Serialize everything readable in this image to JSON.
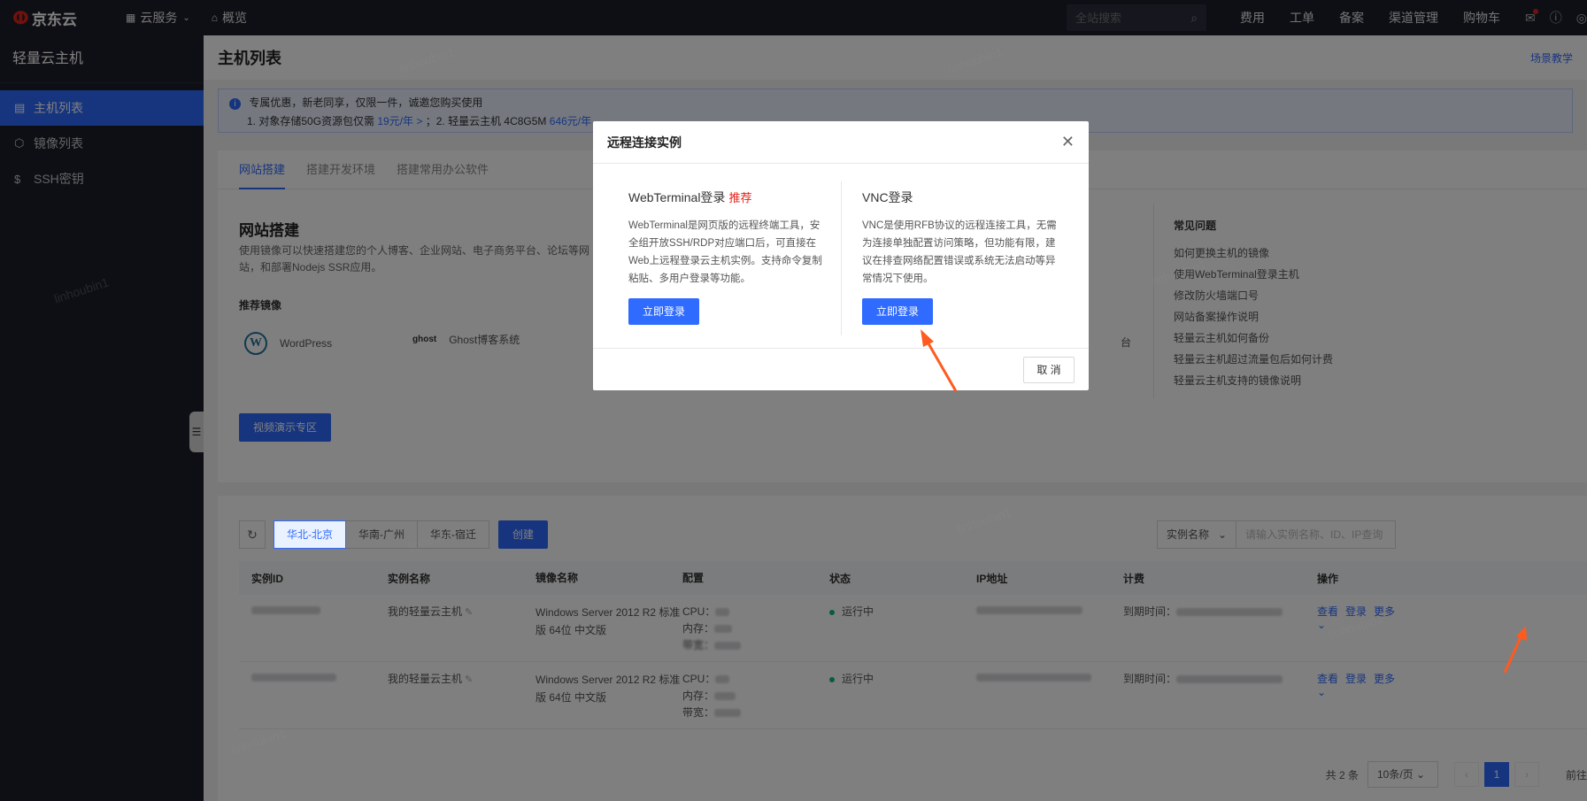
{
  "topnav": {
    "logo": "京东云",
    "cloud_services": "云服务",
    "overview": "概览",
    "search_placeholder": "全站搜索",
    "links": [
      "费用",
      "工单",
      "备案",
      "渠道管理",
      "购物车"
    ]
  },
  "sidebar": {
    "title": "轻量云主机",
    "items": [
      {
        "label": "主机列表",
        "active": true
      },
      {
        "label": "镜像列表",
        "active": false
      },
      {
        "label": "SSH密钥",
        "active": false
      }
    ]
  },
  "page": {
    "title": "主机列表",
    "scene_link": "场景教学"
  },
  "notice": {
    "line1": "专属优惠，新老同享，仅限一件，诚邀您购买使用",
    "line2_a": "1. 对象存储50G资源包仅需 ",
    "line2_price1": "19元/年 >",
    "line2_b": " ；2. 轻量云主机 4C8G5M ",
    "line2_price2": "646元/年"
  },
  "tabs": [
    "网站搭建",
    "搭建开发环境",
    "搭建常用办公软件"
  ],
  "site": {
    "title": "网站搭建",
    "desc": "使用镜像可以快速搭建您的个人博客、企业网站、电子商务平台、论坛等网站，和部署Nodejs SSR应用。",
    "recommend_title": "推荐镜像",
    "images": [
      "WordPress",
      "Ghost博客系统"
    ],
    "ghost_mark": "ghost",
    "extra_fragment": "台",
    "video_button": "视频演示专区"
  },
  "faq": {
    "title": "常见问题",
    "items": [
      "如何更换主机的镜像",
      "使用WebTerminal登录主机",
      "修改防火墙端口号",
      "网站备案操作说明",
      "轻量云主机如何备份",
      "轻量云主机超过流量包后如何计费",
      "轻量云主机支持的镜像说明"
    ]
  },
  "toolbar": {
    "regions": [
      "华北-北京",
      "华南-广州",
      "华东-宿迁"
    ],
    "create": "创建",
    "filter_select": "实例名称",
    "filter_placeholder": "请输入实例名称、ID、IP查询"
  },
  "table": {
    "headers": [
      "实例ID",
      "实例名称",
      "镜像名称",
      "配置",
      "状态",
      "IP地址",
      "计费",
      "操作"
    ],
    "rows": [
      {
        "name": "我的轻量云主机",
        "image": "Windows Server 2012 R2 标准版 64位 中文版",
        "cpu_label": "CPU：",
        "mem_label": "内存：",
        "bw_label": "带宽：",
        "status": "运行中",
        "billing_label": "到期时间：",
        "ops": [
          "查看",
          "登录",
          "更多"
        ]
      },
      {
        "name": "我的轻量云主机",
        "image": "Windows Server 2012 R2 标准版 64位 中文版",
        "cpu_label": "CPU：",
        "mem_label": "内存：",
        "bw_label": "带宽：",
        "status": "运行中",
        "billing_label": "到期时间：",
        "ops": [
          "查看",
          "登录",
          "更多"
        ]
      }
    ]
  },
  "pager": {
    "total": "共 2 条",
    "page_size": "10条/页",
    "current": "1",
    "goto": "前往"
  },
  "modal": {
    "title": "远程连接实例",
    "web": {
      "title": "WebTerminal登录",
      "badge": "推荐",
      "desc": "WebTerminal是网页版的远程终端工具，安全组开放SSH/RDP对应端口后，可直接在Web上远程登录云主机实例。支持命令复制粘贴、多用户登录等功能。",
      "button": "立即登录"
    },
    "vnc": {
      "title": "VNC登录",
      "desc": "VNC是使用RFB协议的远程连接工具，无需为连接单独配置访问策略，但功能有限，建议在排查网络配置错误或系统无法启动等异常情况下使用。",
      "button": "立即登录"
    },
    "cancel": "取 消"
  },
  "watermark": "linhoubin1",
  "colors": {
    "accent": "#2f6bff",
    "nav_bg": "#1d1f2b",
    "brand_red": "#e2231a",
    "status_green": "#0fb97f",
    "arrow": "#ff5a1f"
  }
}
